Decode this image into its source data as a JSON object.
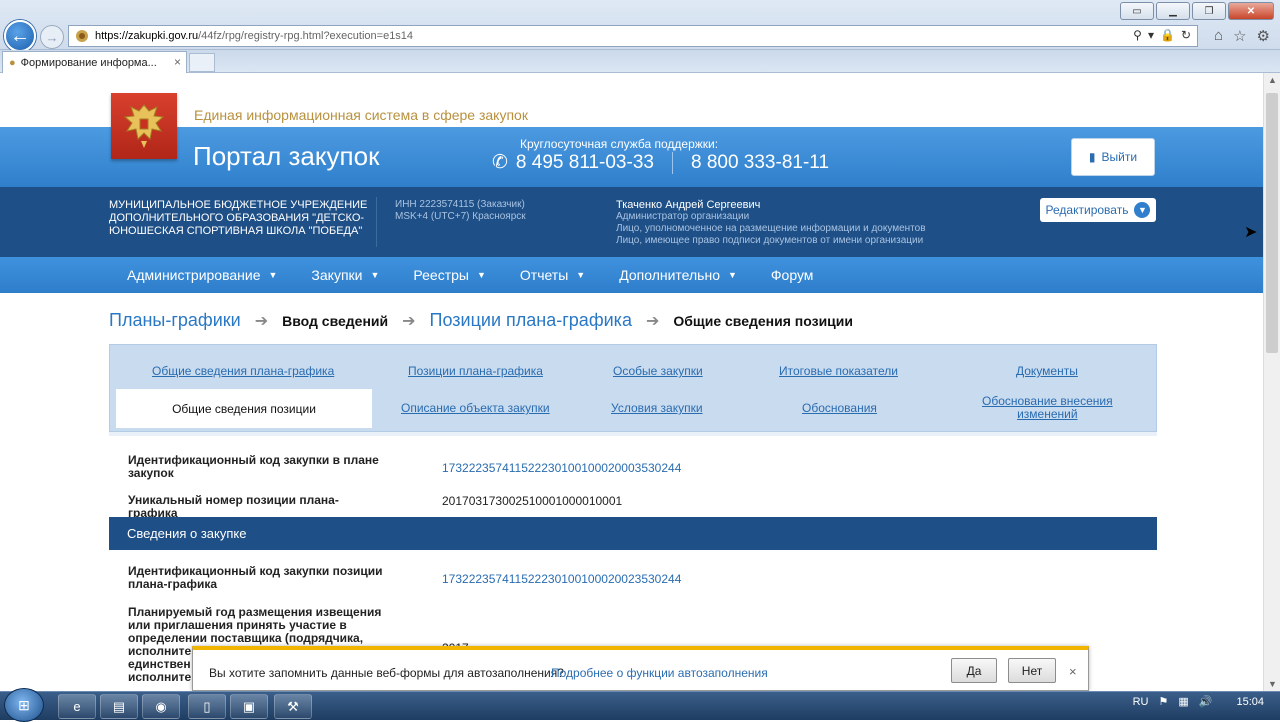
{
  "browser": {
    "url_main": "https://zakupki.gov.ru",
    "url_rest": "/44fz/rpg/registry-rpg.html?execution=e1s14",
    "tab_title": "Формирование информа...",
    "tab_close": "×",
    "back_icon": "←",
    "forward_icon": "→"
  },
  "header": {
    "eis": "Единая информационная система в сфере закупок",
    "portal": "Портал закупок",
    "support_label": "Круглосуточная служба поддержки:",
    "phone1": "8 495 811-03-33",
    "phone2": "8 800 333-81-11",
    "exit_label": "Выйти"
  },
  "org": {
    "name_line1": "МУНИЦИПАЛЬНОЕ БЮДЖЕТНОЕ УЧРЕЖДЕНИЕ",
    "name_line2": "ДОПОЛНИТЕЛЬНОГО ОБРАЗОВАНИЯ \"ДЕТСКО-",
    "name_line3": "ЮНОШЕСКАЯ СПОРТИВНАЯ ШКОЛА \"ПОБЕДА\"",
    "inn": "ИНН 2223574115 (Заказчик)",
    "tz": "MSK+4 (UTC+7) Красноярск",
    "user_name": "Ткаченко Андрей Сергеевич",
    "role1": "Администратор организации",
    "role2": "Лицо, уполномоченное на размещение информации и документов",
    "role3": "Лицо, имеющее право подписи документов от имени организации",
    "edit_label": "Редактировать"
  },
  "nav": [
    "Администрирование",
    "Закупки",
    "Реестры",
    "Отчеты",
    "Дополнительно",
    "Форум"
  ],
  "breadcrumbs": {
    "c1": "Планы-графики",
    "c2": "Ввод сведений",
    "c3": "Позиции плана-графика",
    "c4": "Общие сведения позиции"
  },
  "tabs": {
    "top": [
      "Общие сведения плана-графика",
      "Позиции плана-графика",
      "Особые закупки",
      "Итоговые показатели",
      "Документы"
    ],
    "bottom_active": "Общие сведения позиции",
    "bottom": [
      "Описание объекта закупки",
      "Условия закупки",
      "Обоснования"
    ],
    "bottom_last_line1": "Обоснование внесения",
    "bottom_last_line2": "изменений"
  },
  "fields": {
    "ikz_label_1": "Идентификационный код закупки в плане",
    "ikz_label_2": "закупок",
    "ikz_value": "173222357411522230100100020003530244",
    "unique_label": "Уникальный номер позиции плана-графика",
    "unique_value": "201703173002510001000010001"
  },
  "section": {
    "title": "Сведения о закупке",
    "ikz_pos_label_1": "Идентификационный код закупки позиции",
    "ikz_pos_label_2": "плана-графика",
    "ikz_pos_value": "173222357411522230100100020023530244",
    "plan_label_1": "Планируемый год размещения извещения",
    "plan_label_2": "или приглашения принять участие в",
    "plan_label_3": "определении поставщика (подрядчика,",
    "plan_label_4": "исполните",
    "plan_label_5": "единствен",
    "plan_label_6": "исполните",
    "plan_value": "2017"
  },
  "autofill": {
    "question": "Вы хотите запомнить данные веб-формы для автозаполнения?",
    "more": "Подробнее о функции автозаполнения",
    "yes": "Да",
    "no": "Нет",
    "close": "×"
  },
  "taskbar": {
    "lang": "RU",
    "time": "15:04"
  }
}
